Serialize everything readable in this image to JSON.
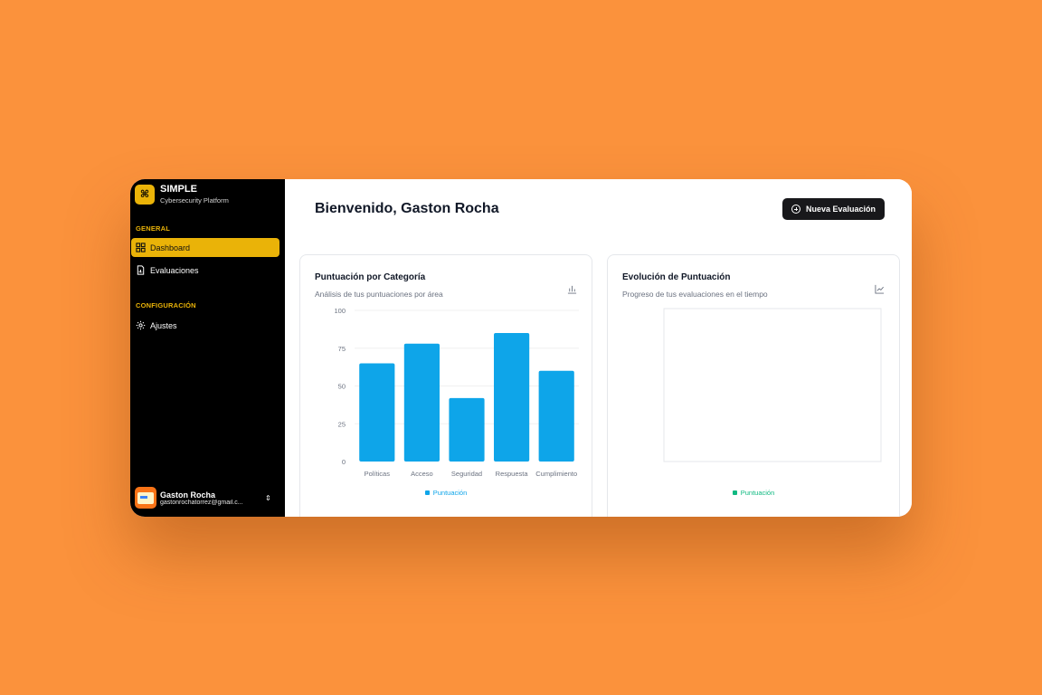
{
  "sidebar": {
    "brand_name": "SIMPLE",
    "brand_sub": "Cybersecurity Platform",
    "brand_icon": "command-icon",
    "section_general": "GENERAL",
    "section_config": "CONFIGURACIÓN",
    "items": [
      {
        "label": "Dashboard",
        "icon": "dashboard-grid-icon",
        "active": true
      },
      {
        "label": "Evaluaciones",
        "icon": "file-chart-icon",
        "active": false
      },
      {
        "label": "Ajustes",
        "icon": "gear-icon",
        "active": false
      }
    ],
    "user": {
      "name": "Gaston Rocha",
      "email": "gastonrochatorrez@gmail.c..."
    }
  },
  "header": {
    "title": "Bienvenido, Gaston Rocha",
    "new_button": "Nueva Evaluación"
  },
  "colors": {
    "accent": "#eab308",
    "bar": "#0ea5e9",
    "line_series": "#10b981",
    "background": "#fb923c"
  },
  "cards": {
    "left": {
      "title": "Puntuación por Categoría",
      "subtitle": "Análisis de tus puntuaciones por área",
      "icon": "bar-chart-icon"
    },
    "right": {
      "title": "Evolución de Puntuación",
      "subtitle": "Progreso de tus evaluaciones en el tiempo",
      "icon": "line-chart-icon"
    }
  },
  "chart_data": [
    {
      "type": "bar",
      "categories": [
        "Políticas",
        "Acceso",
        "Seguridad",
        "Respuesta",
        "Cumplimiento"
      ],
      "series": [
        {
          "name": "Puntuación",
          "values": [
            65,
            78,
            42,
            85,
            60
          ]
        }
      ],
      "yticks": [
        "0",
        "25",
        "50",
        "75",
        "100"
      ],
      "ylim": [
        0,
        100
      ],
      "grid": true,
      "legend": "bottom"
    },
    {
      "type": "line",
      "categories": [],
      "series": [
        {
          "name": "Puntuación",
          "values": []
        }
      ],
      "legend": "bottom"
    }
  ]
}
